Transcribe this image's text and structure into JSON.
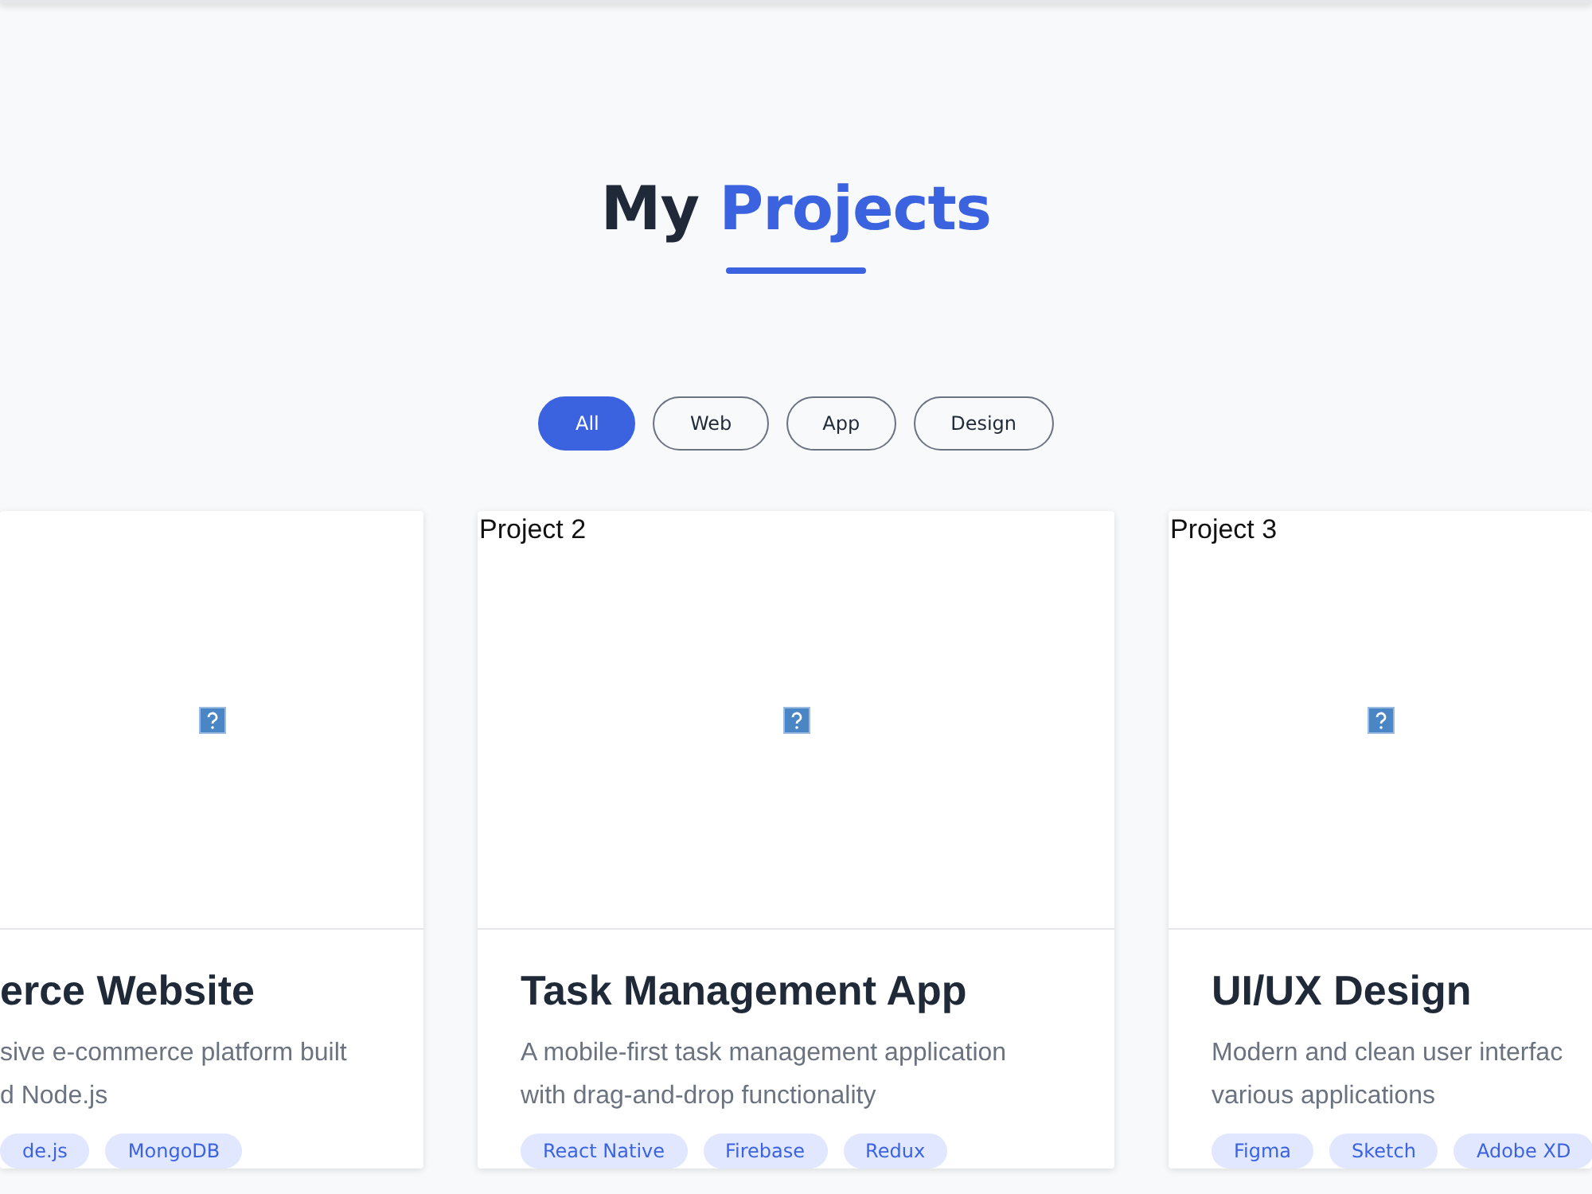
{
  "heading": {
    "text": "My",
    "highlight": "Projects"
  },
  "filters": [
    {
      "label": "All",
      "selected": true
    },
    {
      "label": "Web",
      "selected": false
    },
    {
      "label": "App",
      "selected": false
    },
    {
      "label": "Design",
      "selected": false
    }
  ],
  "projects": [
    {
      "title": "erce Website",
      "description": "sive e-commerce platform built\nd Node.js",
      "tags": [
        "de.js",
        "MongoDB"
      ]
    },
    {
      "image_alt": "Project 2",
      "title": "Task Management App",
      "description": "A mobile-first task management application\nwith drag-and-drop functionality",
      "tags": [
        "React Native",
        "Firebase",
        "Redux"
      ]
    },
    {
      "image_alt": "Project 3",
      "title": "UI/UX Design",
      "description": "Modern and clean user interfac\nvarious applications",
      "tags": [
        "Figma",
        "Sketch",
        "Adobe XD"
      ]
    }
  ]
}
